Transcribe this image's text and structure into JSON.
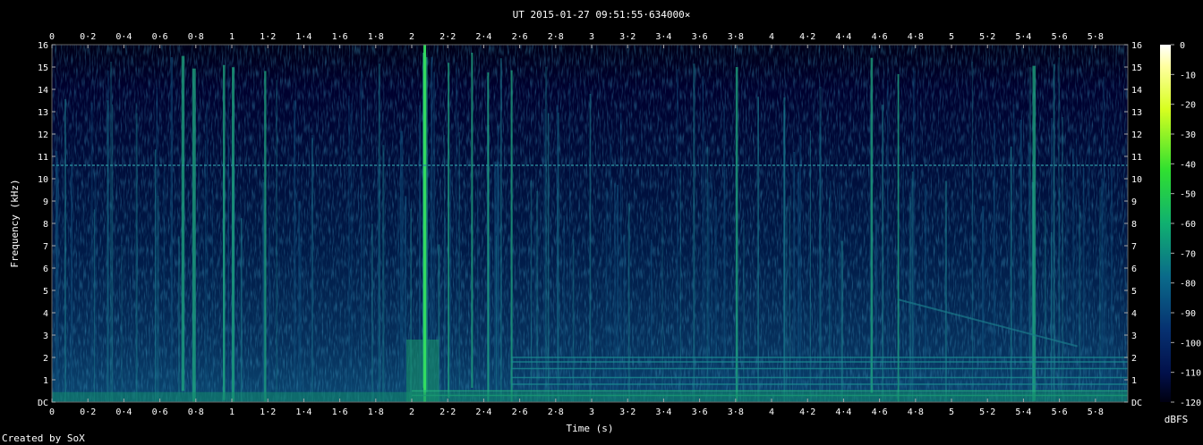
{
  "chart_data": {
    "type": "heatmap",
    "title": "UT 2015-01-27 09:51:55·634000×",
    "xlabel": "Time (s)",
    "ylabel": "Frequency (kHz)",
    "x_ticks": [
      "0",
      "0·2",
      "0·4",
      "0·6",
      "0·8",
      "1",
      "1·2",
      "1·4",
      "1·6",
      "1·8",
      "2",
      "2·2",
      "2·4",
      "2·6",
      "2·8",
      "3",
      "3·2",
      "3·4",
      "3·6",
      "3·8",
      "4",
      "4·2",
      "4·4",
      "4·6",
      "4·8",
      "5",
      "5·2",
      "5·4",
      "5·6",
      "5·8"
    ],
    "x_tick_values": [
      0,
      0.2,
      0.4,
      0.6,
      0.8,
      1,
      1.2,
      1.4,
      1.6,
      1.8,
      2,
      2.2,
      2.4,
      2.6,
      2.8,
      3,
      3.2,
      3.4,
      3.6,
      3.8,
      4,
      4.2,
      4.4,
      4.6,
      4.8,
      5,
      5.2,
      5.4,
      5.6,
      5.8
    ],
    "xlim": [
      0,
      5.98
    ],
    "y_ticks": [
      "DC",
      "1",
      "2",
      "3",
      "4",
      "5",
      "6",
      "7",
      "8",
      "9",
      "10",
      "11",
      "12",
      "13",
      "14",
      "15",
      "16"
    ],
    "ylim": [
      0,
      16
    ],
    "colorbar": {
      "label": "dBFS",
      "ticks": [
        "0",
        "-10",
        "-20",
        "-30",
        "-40",
        "-50",
        "-60",
        "-70",
        "-80",
        "-90",
        "-100",
        "-110",
        "-120"
      ],
      "range": [
        -120,
        0
      ]
    },
    "strong_events_s": [
      0.72,
      0.78,
      0.95,
      1.0,
      1.18,
      2.06,
      2.08,
      2.2,
      2.33,
      2.42,
      2.55,
      3.8,
      4.55,
      4.7,
      5.45
    ],
    "tonal_line_khz": 10.6,
    "low_freq_lines_khz": [
      0.3,
      0.5,
      0.8,
      1.1,
      1.5,
      1.8,
      2.0
    ],
    "footer": "Created by SoX"
  },
  "colors": {
    "background": "#000000",
    "low": "#000040",
    "mid": "#0a4a7a",
    "high": "#25c070",
    "peak": "#40ff40"
  }
}
